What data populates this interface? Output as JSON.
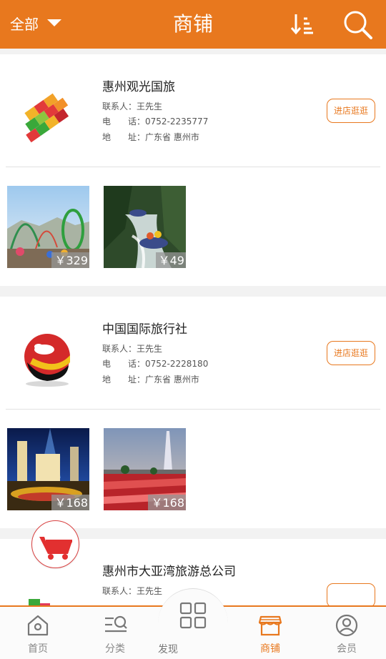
{
  "header": {
    "filter_label": "全部",
    "title": "商铺",
    "sort_icon": "sort-descending-icon",
    "search_icon": "search-icon",
    "bg_color": "#e8781e"
  },
  "shops": [
    {
      "name": "惠州观光国旅",
      "contact_label": "联系人：",
      "contact": "王先生",
      "phone_label": "电　　话：",
      "phone": "0752-2235777",
      "address_label": "地　　址：",
      "address": "广东省 惠州市",
      "visit_label": "进店逛逛",
      "products": [
        {
          "price": "￥329",
          "image": "amusement-park-photo"
        },
        {
          "price": "￥49",
          "image": "river-rafting-photo"
        }
      ]
    },
    {
      "name": "中国国际旅行社",
      "contact_label": "联系人：",
      "contact": "王先生",
      "phone_label": "电　　话：",
      "phone": "0752-2228180",
      "address_label": "地　　址：",
      "address": "广东省 惠州市",
      "visit_label": "进店逛逛",
      "products": [
        {
          "price": "￥168",
          "image": "city-night-lights-photo"
        },
        {
          "price": "￥168",
          "image": "canton-tower-flowers-photo"
        }
      ]
    },
    {
      "name": "惠州市大亚湾旅游总公司",
      "contact_label": "联系人：",
      "contact": "王先生"
    }
  ],
  "tabbar": {
    "items": [
      {
        "label": "首页",
        "icon": "home-icon"
      },
      {
        "label": "分类",
        "icon": "category-search-icon"
      },
      {
        "label": "发现",
        "icon": "grid-icon"
      },
      {
        "label": "商铺",
        "icon": "store-icon",
        "active": true
      },
      {
        "label": "会员",
        "icon": "user-icon"
      }
    ],
    "accent_color": "#e8781e"
  },
  "cart": {
    "icon": "shopping-cart-icon"
  }
}
